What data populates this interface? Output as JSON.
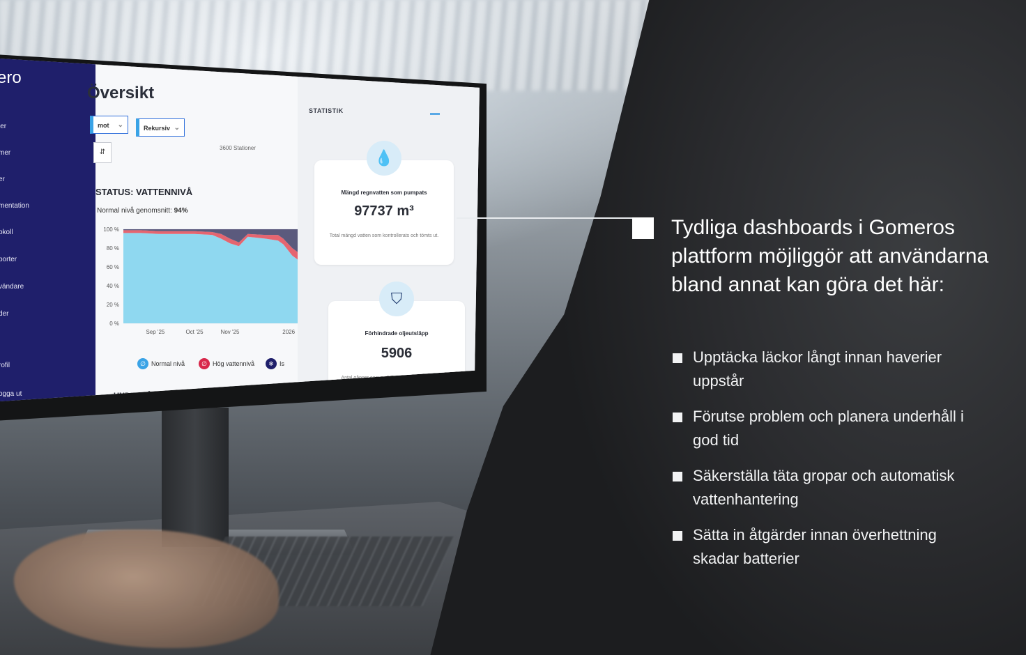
{
  "dashboard": {
    "brand": "ero",
    "nav_items": [
      "ler",
      "mer",
      "er",
      "mentation",
      "okoll",
      "porter",
      "vändare",
      "der",
      "rofil",
      "ogga ut"
    ],
    "page_title": "Översikt",
    "filter_1": "mot",
    "filter_2": "Rekursiv",
    "small_button": "⇵",
    "stations": "3600 Stationer",
    "status_title": "STATUS: VATTENNIVÅ",
    "avg_label": "Normal nivå genomsnitt:",
    "avg_value": "94%",
    "chart_data": {
      "type": "area",
      "title": "STATUS: VATTENNIVÅ",
      "y_ticks": [
        "100 %",
        "80 %",
        "60 %",
        "40 %",
        "20 %",
        "0 %"
      ],
      "x_ticks": [
        "Sep '25",
        "Oct '25",
        "Nov '25",
        "2026"
      ],
      "ylim": [
        0,
        100
      ],
      "x": [
        0,
        0.1,
        0.2,
        0.3,
        0.4,
        0.5,
        0.55,
        0.6,
        0.65,
        0.7,
        0.8,
        0.87,
        0.9,
        0.95,
        1.0
      ],
      "series": [
        {
          "name": "Normal nivå",
          "color": "#8fd8f0",
          "values": [
            96,
            96,
            95,
            95,
            95,
            94,
            90,
            85,
            82,
            92,
            90,
            88,
            84,
            72,
            65
          ]
        },
        {
          "name": "Hög vattennivå",
          "color": "#e56570",
          "values": [
            3,
            3,
            3,
            3,
            3,
            3,
            5,
            5,
            4,
            3,
            4,
            6,
            6,
            8,
            8
          ]
        },
        {
          "name": "Is",
          "color": "#5b5a7d",
          "values": [
            1,
            1,
            2,
            2,
            2,
            3,
            5,
            10,
            14,
            5,
            6,
            6,
            10,
            20,
            27
          ]
        }
      ],
      "legend": "bottom"
    },
    "legend": {
      "normal": "Normal nivå",
      "high": "Hög vattennivå",
      "ice": "Is"
    },
    "underhall": "UNDERHÅLL",
    "stats_title": "STATISTIK",
    "card1": {
      "icon": "water-drop-icon",
      "label": "Mängd regnvatten som pumpats",
      "value": "97737 m³",
      "desc": "Total mängd vatten som kontrollerats och tömts ut."
    },
    "card2": {
      "icon": "shield-icon",
      "label": "Förhindrade oljeutsläpp",
      "value": "5906",
      "desc": "Antal gånger som er SIPP-utrustning har detekterat hög oljehalt och därmed förhindrat"
    }
  },
  "callout": {
    "headline": "Tydliga dashboards i Gomeros plattform möjliggör att användarna bland annat kan göra det här:",
    "bullets": [
      "Upptäcka läckor långt innan haverier uppstår",
      "Förutse problem och planera underhåll i god tid",
      "Säkerställa täta gropar och automatisk vattenhantering",
      "Sätta in åtgärder innan överhettning skadar batterier"
    ]
  },
  "colors": {
    "sidebar": "#1f1f6b",
    "accent": "#2f6fdb",
    "text_light": "#ffffff"
  }
}
